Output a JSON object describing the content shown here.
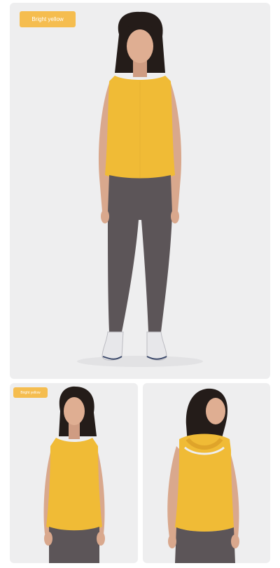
{
  "main_photo": {
    "color_label": "Bright yellow"
  },
  "detail_front_photo": {
    "color_label": "Bright yellow"
  },
  "detail_back_photo": {},
  "colors": {
    "badge": "#f5bd4f",
    "panel_background": "#eeeeef",
    "top": "#f0bb36",
    "top_shadow": "#dfa42a",
    "leggings": "#5c5558",
    "hair": "#241c19",
    "skin": "#d9a88d",
    "sneaker": "#e7e7ea"
  }
}
